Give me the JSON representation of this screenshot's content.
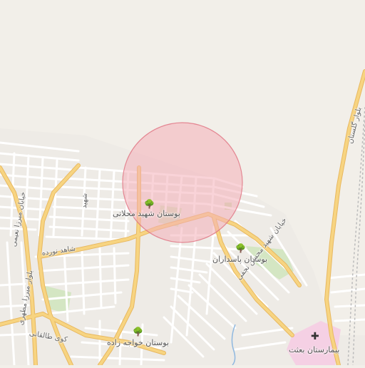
{
  "colors": {
    "background": "#f2efe9",
    "minor_road": "#ffffff",
    "major_road": "#f7d481",
    "major_road_casing": "#e8b860",
    "park": "#d4e6c3",
    "hospital": "#f5d0e4",
    "highlight_fill": "#f4aeb8",
    "highlight_stroke": "#e07080",
    "railway": "#bbbbbb",
    "water": "#8fb8e0"
  },
  "map": {
    "highlight_circle": {
      "label": ""
    },
    "parks": [
      {
        "name": "بوستان شهید محلاتی",
        "icon": "tree-icon"
      },
      {
        "name": "بوستان پاسداران",
        "icon": "tree-icon"
      },
      {
        "name": "بوستان خواجه زاده",
        "icon": "tree-icon"
      }
    ],
    "hospitals": [
      {
        "name": "بیمارستان بعثت",
        "icon": "hospital-cross-icon"
      }
    ],
    "streets": [
      {
        "name": "خیابان شهید محسن نجفی"
      },
      {
        "name": "شاهد نورده"
      },
      {
        "name": "کوی طالقانی"
      },
      {
        "name": "بلوار میرزا مطهری"
      },
      {
        "name": "خیابان میرزا نعیمی"
      },
      {
        "name": "بلوار گلستان"
      },
      {
        "name": "شهید"
      }
    ]
  }
}
